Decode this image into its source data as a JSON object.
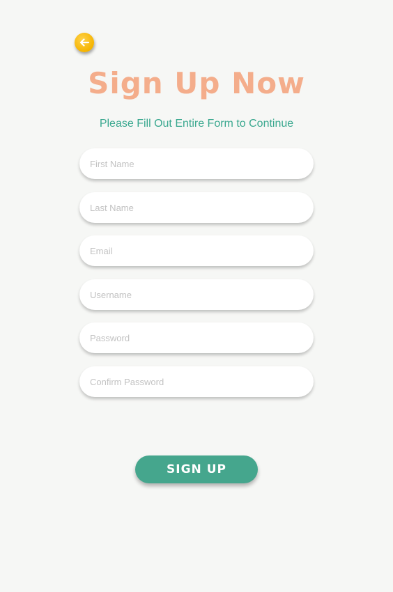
{
  "header": {
    "back_icon": "arrow-left-icon",
    "title": "Sign Up Now",
    "subtitle": "Please Fill Out Entire Form to Continue"
  },
  "form": {
    "first_name": {
      "placeholder": "First Name",
      "value": ""
    },
    "last_name": {
      "placeholder": "Last Name",
      "value": ""
    },
    "email": {
      "placeholder": "Email",
      "value": ""
    },
    "username": {
      "placeholder": "Username",
      "value": ""
    },
    "password": {
      "placeholder": "Password",
      "value": ""
    },
    "confirm_password": {
      "placeholder": "Confirm Password",
      "value": ""
    },
    "submit_label": "SIGN UP"
  },
  "colors": {
    "background": "#f6f7f5",
    "title": "#f4ad8b",
    "subtitle": "#3aa88f",
    "button": "#45a68d",
    "back_button": "#f5b400"
  }
}
